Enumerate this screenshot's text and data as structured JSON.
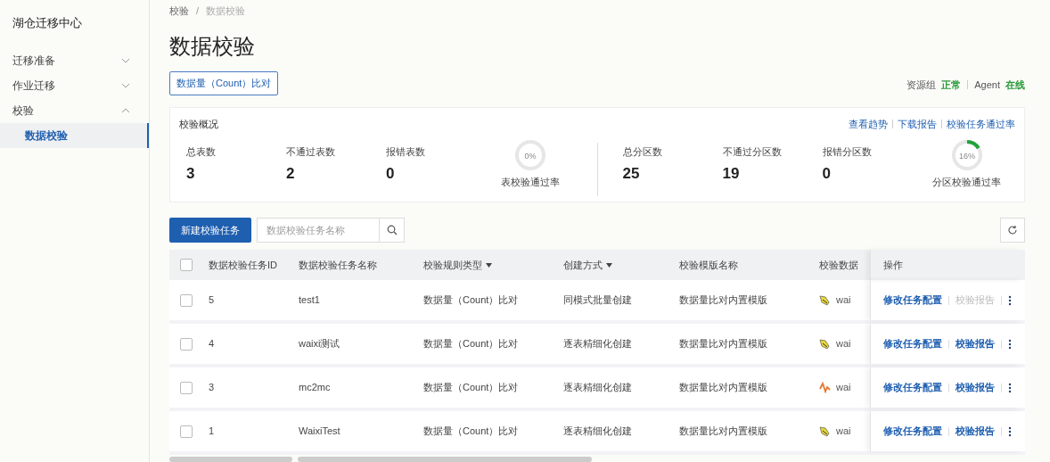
{
  "sidebar": {
    "title": "湖仓迁移中心",
    "items": [
      {
        "label": "迁移准备",
        "expanded": false
      },
      {
        "label": "作业迁移",
        "expanded": false
      },
      {
        "label": "校验",
        "expanded": true,
        "children": [
          {
            "label": "数据校验",
            "selected": true
          }
        ]
      }
    ]
  },
  "breadcrumb": {
    "separator": "/",
    "items": [
      "校验",
      "数据校验"
    ]
  },
  "page_title": "数据校验",
  "rule_tab": "数据量（Count）比对",
  "status": [
    {
      "label": "资源组",
      "value": "正常"
    },
    {
      "label": "Agent",
      "value": "在线"
    }
  ],
  "overview": {
    "title": "校验概况",
    "links": [
      "查看趋势",
      "下载报告",
      "校验任务通过率"
    ],
    "groups": [
      {
        "stats": [
          {
            "label": "总表数",
            "value": "3"
          },
          {
            "label": "不通过表数",
            "value": "2"
          },
          {
            "label": "报错表数",
            "value": "0"
          }
        ],
        "ring": {
          "text": "0%",
          "level": 0,
          "label": "表校验通过率"
        }
      },
      {
        "stats": [
          {
            "label": "总分区数",
            "value": "25"
          },
          {
            "label": "不通过分区数",
            "value": "19"
          },
          {
            "label": "报错分区数",
            "value": "0"
          }
        ],
        "ring": {
          "text": "16%",
          "level": 0.16,
          "label": "分区校验通过率"
        }
      }
    ]
  },
  "toolbar": {
    "create_button": "新建校验任务",
    "search": {
      "placeholder": "数据校验任务名称"
    }
  },
  "table": {
    "header_checkbox": {
      "checked": false
    },
    "columns": [
      {
        "label": "数据校验任务ID",
        "sortable": false
      },
      {
        "label": "数据校验任务名称",
        "sortable": false
      },
      {
        "label": "校验规则类型",
        "sortable": true
      },
      {
        "label": "创建方式",
        "sortable": true
      },
      {
        "label": "校验模版名称",
        "sortable": false
      },
      {
        "label": "校验数据",
        "sortable": false
      },
      {
        "label": "操作",
        "sortable": false
      }
    ],
    "rows": [
      {
        "checked": false,
        "id": "5",
        "name": "test1",
        "rule": "数据量（Count）比对",
        "method": "同模式批量创建",
        "template": "数据量比对内置模版",
        "source": {
          "kind": "tool",
          "text": "wai"
        },
        "actions": [
          {
            "label": "修改任务配置",
            "disabled": false
          },
          {
            "label": "校验报告",
            "disabled": true
          }
        ]
      },
      {
        "checked": false,
        "id": "4",
        "name": "waixi测试",
        "rule": "数据量（Count）比对",
        "method": "逐表精细化创建",
        "template": "数据量比对内置模版",
        "source": {
          "kind": "tool",
          "text": "wai"
        },
        "actions": [
          {
            "label": "修改任务配置",
            "disabled": false
          },
          {
            "label": "校验报告",
            "disabled": false
          }
        ]
      },
      {
        "checked": false,
        "id": "3",
        "name": "mc2mc",
        "rule": "数据量（Count）比对",
        "method": "逐表精细化创建",
        "template": "数据量比对内置模版",
        "source": {
          "kind": "wave",
          "text": "wai"
        },
        "actions": [
          {
            "label": "修改任务配置",
            "disabled": false
          },
          {
            "label": "校验报告",
            "disabled": false
          }
        ]
      },
      {
        "checked": false,
        "id": "1",
        "name": "WaixiTest",
        "rule": "数据量（Count）比对",
        "method": "逐表精细化创建",
        "template": "数据量比对内置模版",
        "source": {
          "kind": "tool",
          "text": "wai"
        },
        "actions": [
          {
            "label": "修改任务配置",
            "disabled": false
          },
          {
            "label": "校验报告",
            "disabled": false
          }
        ]
      }
    ]
  }
}
